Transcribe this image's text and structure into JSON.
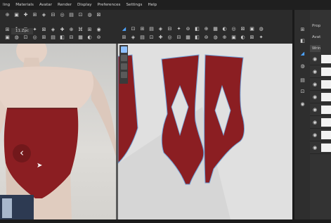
{
  "menu": [
    "ling",
    "Materials",
    "Avatar",
    "Render",
    "Display",
    "Preferences",
    "Settings",
    "Help"
  ],
  "tab_3d": "11.Zpc",
  "right_panel": {
    "tab1": "Prop",
    "tab2": "Avat",
    "tab3": "Wrin",
    "row_count": 8
  },
  "colors": {
    "garment": "#8b1e22",
    "pattern_outline": "#6fa0d8",
    "skin": "#e7d3c8",
    "workspace_2d": "#e0e0e0"
  },
  "icons": [
    "cursor-icon",
    "left-arrow-icon",
    "eye-icon",
    "toolbar-icons"
  ]
}
